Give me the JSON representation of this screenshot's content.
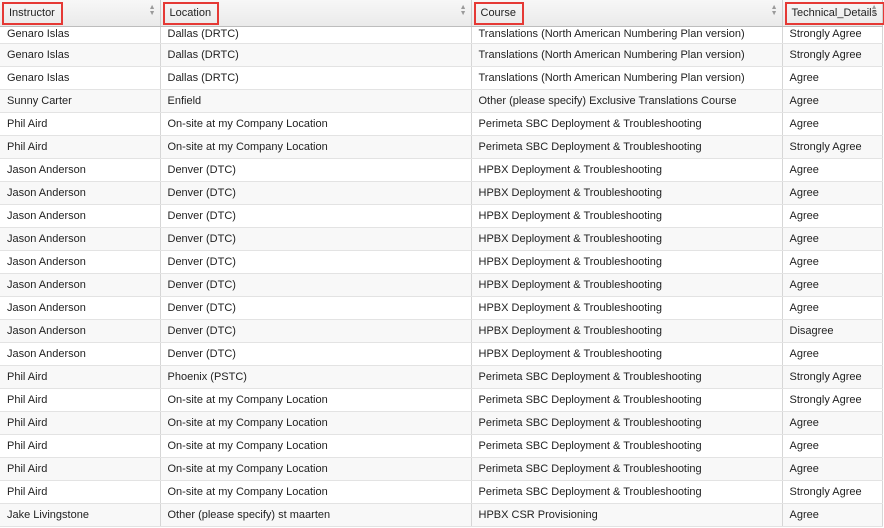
{
  "table": {
    "columns": [
      {
        "label": "Instructor"
      },
      {
        "label": "Location"
      },
      {
        "label": "Course"
      },
      {
        "label": "Technical_Details"
      }
    ],
    "rows": [
      [
        "Genaro Islas",
        "Dallas (DRTC)",
        "Translations (North American Numbering Plan version)",
        "Strongly Agree"
      ],
      [
        "Genaro Islas",
        "Dallas (DRTC)",
        "Translations (North American Numbering Plan version)",
        "Strongly Agree"
      ],
      [
        "Genaro Islas",
        "Dallas (DRTC)",
        "Translations (North American Numbering Plan version)",
        "Agree"
      ],
      [
        "Sunny Carter",
        "Enfield",
        "Other (please specify) Exclusive Translations Course",
        "Agree"
      ],
      [
        "Phil Aird",
        "On-site at my Company Location",
        "Perimeta SBC Deployment & Troubleshooting",
        "Agree"
      ],
      [
        "Phil Aird",
        "On-site at my Company Location",
        "Perimeta SBC Deployment & Troubleshooting",
        "Strongly Agree"
      ],
      [
        "Jason Anderson",
        "Denver (DTC)",
        "HPBX Deployment & Troubleshooting",
        "Agree"
      ],
      [
        "Jason Anderson",
        "Denver (DTC)",
        "HPBX Deployment & Troubleshooting",
        "Agree"
      ],
      [
        "Jason Anderson",
        "Denver (DTC)",
        "HPBX Deployment & Troubleshooting",
        "Agree"
      ],
      [
        "Jason Anderson",
        "Denver (DTC)",
        "HPBX Deployment & Troubleshooting",
        "Agree"
      ],
      [
        "Jason Anderson",
        "Denver (DTC)",
        "HPBX Deployment & Troubleshooting",
        "Agree"
      ],
      [
        "Jason Anderson",
        "Denver (DTC)",
        "HPBX Deployment & Troubleshooting",
        "Agree"
      ],
      [
        "Jason Anderson",
        "Denver (DTC)",
        "HPBX Deployment & Troubleshooting",
        "Agree"
      ],
      [
        "Jason Anderson",
        "Denver (DTC)",
        "HPBX Deployment & Troubleshooting",
        "Disagree"
      ],
      [
        "Jason Anderson",
        "Denver (DTC)",
        "HPBX Deployment & Troubleshooting",
        "Agree"
      ],
      [
        "Phil Aird",
        "Phoenix (PSTC)",
        "Perimeta SBC Deployment & Troubleshooting",
        "Strongly Agree"
      ],
      [
        "Phil Aird",
        "On-site at my Company Location",
        "Perimeta SBC Deployment & Troubleshooting",
        "Strongly Agree"
      ],
      [
        "Phil Aird",
        "On-site at my Company Location",
        "Perimeta SBC Deployment & Troubleshooting",
        "Agree"
      ],
      [
        "Phil Aird",
        "On-site at my Company Location",
        "Perimeta SBC Deployment & Troubleshooting",
        "Agree"
      ],
      [
        "Phil Aird",
        "On-site at my Company Location",
        "Perimeta SBC Deployment & Troubleshooting",
        "Agree"
      ],
      [
        "Phil Aird",
        "On-site at my Company Location",
        "Perimeta SBC Deployment & Troubleshooting",
        "Strongly Agree"
      ],
      [
        "Jake Livingstone",
        "Other (please specify) st maarten",
        "HPBX CSR Provisioning",
        "Agree"
      ]
    ]
  },
  "icons": {
    "sort": "sort-arrows-icon"
  },
  "colors": {
    "highlight_box": "#e53935",
    "header_bg": "#efefef",
    "alt_row_bg": "#f8f8f8"
  }
}
